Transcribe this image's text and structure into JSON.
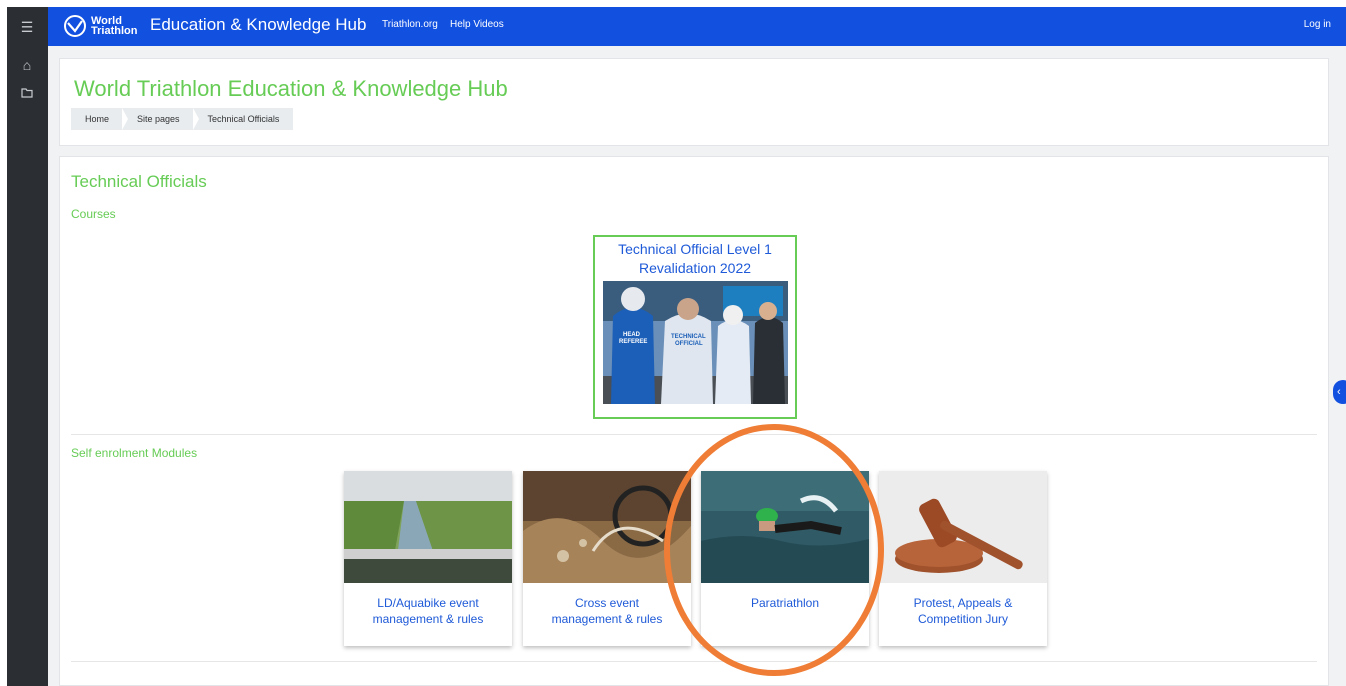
{
  "topbar": {
    "logo_line1": "World",
    "logo_line2": "Triathlon",
    "site_name": "Education & Knowledge Hub",
    "links": [
      "Triathlon.org",
      "Help Videos"
    ],
    "login": "Log in"
  },
  "leftbar": {
    "icons": [
      "menu-icon",
      "home-icon",
      "folder-icon"
    ]
  },
  "header": {
    "title": "World Triathlon Education & Knowledge Hub",
    "breadcrumb": [
      "Home",
      "Site pages",
      "Technical Officials"
    ]
  },
  "content": {
    "section_title": "Technical Officials",
    "courses_heading": "Courses",
    "course": {
      "title_line1": "Technical Official Level 1",
      "title_line2": "Revalidation 2022"
    },
    "modules_heading": "Self enrolment Modules",
    "modules": [
      {
        "line1": "LD/Aquabike event",
        "line2": "management & rules"
      },
      {
        "line1": "Cross event",
        "line2": "management & rules"
      },
      {
        "line1": "Paratriathlon",
        "line2": ""
      },
      {
        "line1": "Protest, Appeals &",
        "line2": "Competition Jury"
      }
    ]
  },
  "colors": {
    "brand_blue": "#1250e0",
    "accent_green": "#66cc55",
    "link_blue": "#1f5ad8",
    "highlight_orange": "#ef7d35"
  }
}
